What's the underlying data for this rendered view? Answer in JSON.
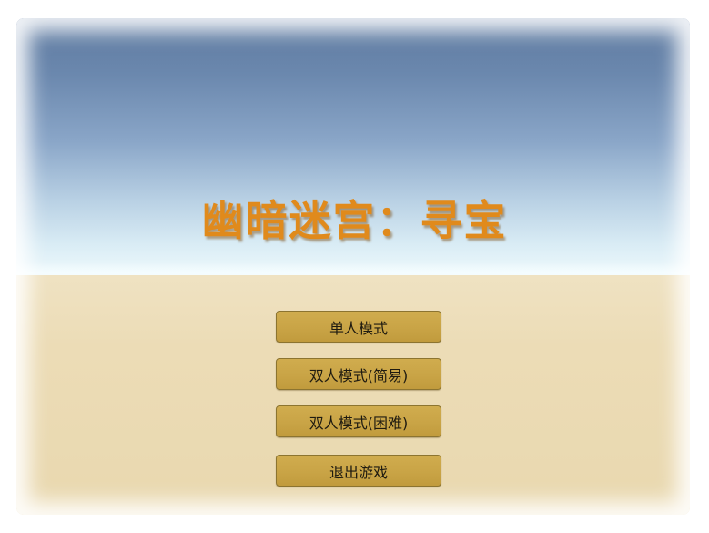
{
  "game": {
    "title": "幽暗迷宫：寻宝"
  },
  "menu": {
    "single_player": "单人模式",
    "two_player_easy": "双人模式(简易)",
    "two_player_hard": "双人模式(困难)",
    "exit": "退出游戏"
  },
  "colors": {
    "title": "#e08a1c",
    "button_fill": "#c9a446",
    "sky_top": "#5e7aa0",
    "ground": "#ecdcb6"
  }
}
